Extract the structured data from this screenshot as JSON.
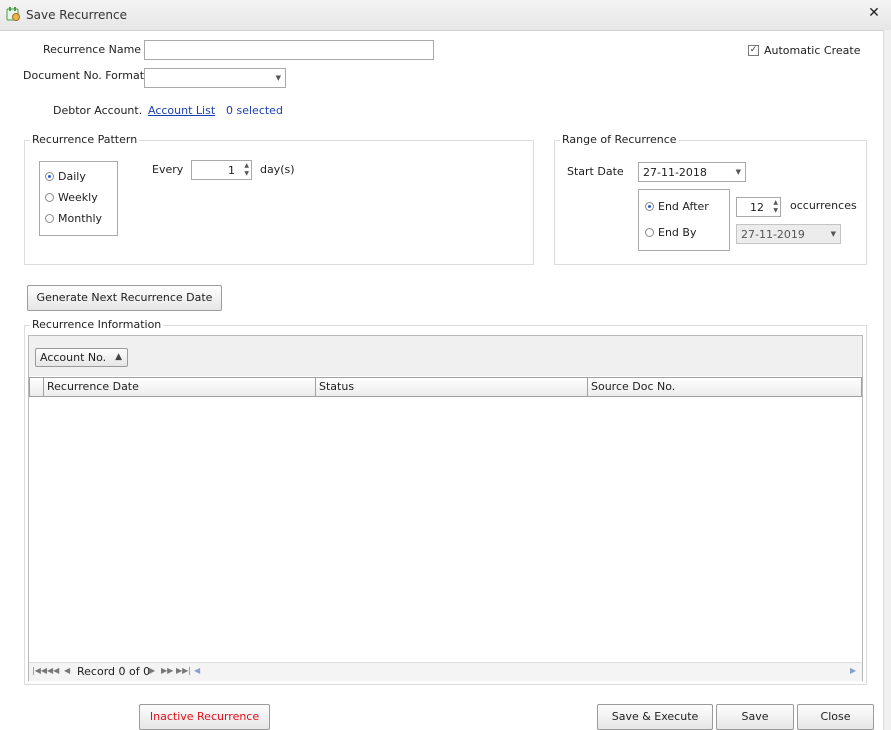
{
  "window": {
    "title": "Save Recurrence",
    "close_symbol": "✕"
  },
  "form": {
    "recurrence_name_label": "Recurrence Name",
    "recurrence_name_value": "",
    "doc_format_label": "Document No. Format",
    "doc_format_value": "",
    "debtor_label": "Debtor Account.",
    "account_list_link": "Account List",
    "selected_text": "0 selected",
    "automatic_create_label": "Automatic Create",
    "automatic_create_checked": true
  },
  "pattern": {
    "title": "Recurrence Pattern",
    "options": [
      "Daily",
      "Weekly",
      "Monthly"
    ],
    "selected": "Daily",
    "every_label": "Every",
    "every_value": "1",
    "unit_label": "day(s)"
  },
  "range": {
    "title": "Range of Recurrence",
    "start_label": "Start Date",
    "start_value": "27-11-2018",
    "end_after_label": "End After",
    "end_after_value": "12",
    "occurrences_label": "occurrences",
    "end_by_label": "End By",
    "end_by_value": "27-11-2019",
    "selected": "End After"
  },
  "generate_button": "Generate Next Recurrence Date",
  "info": {
    "title": "Recurrence Information",
    "group_by_chip": "Account No.",
    "columns": [
      "Recurrence Date",
      "Status",
      "Source Doc No."
    ],
    "rows": [],
    "record_text": "Record 0 of 0"
  },
  "footer": {
    "inactive_button": "Inactive Recurrence",
    "save_execute_button": "Save & Execute",
    "save_button": "Save",
    "close_button": "Close"
  },
  "colors": {
    "link": "#1a3fb0",
    "inactive_text": "#e0101a",
    "radio_dot": "#2a5bd7"
  }
}
